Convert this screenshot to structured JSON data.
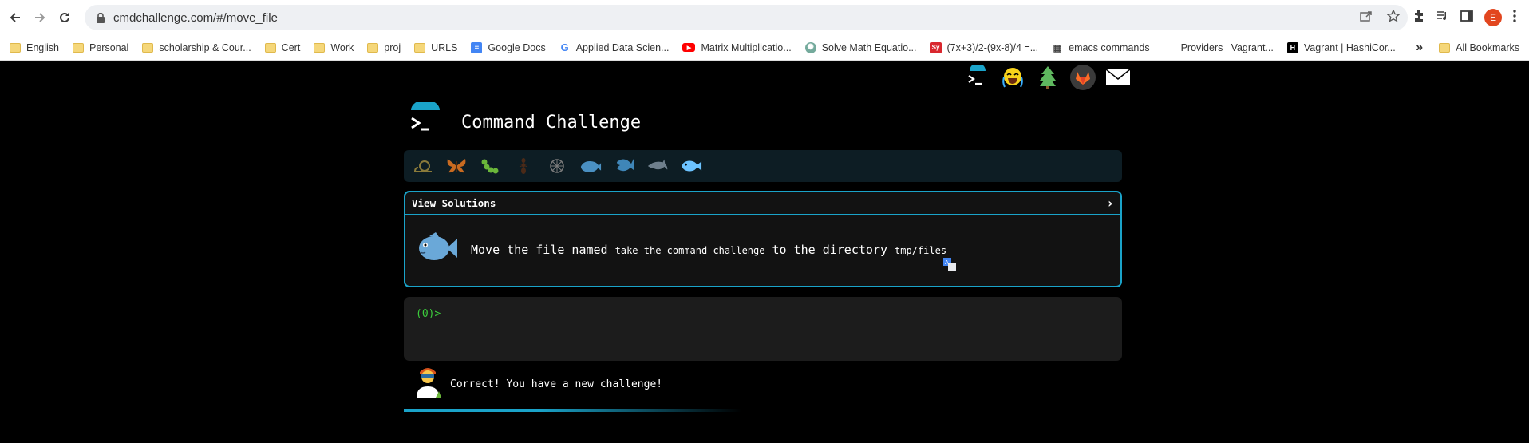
{
  "browser": {
    "url": "cmdchallenge.com/#/move_file",
    "profile_initial": "E",
    "bookmarks": [
      {
        "label": "English",
        "icon": "folder-icon"
      },
      {
        "label": "Personal",
        "icon": "folder-icon"
      },
      {
        "label": "scholarship & Cour...",
        "icon": "folder-icon"
      },
      {
        "label": "Cert",
        "icon": "folder-icon"
      },
      {
        "label": "Work",
        "icon": "folder-icon"
      },
      {
        "label": "proj",
        "icon": "folder-icon"
      },
      {
        "label": "URLS",
        "icon": "folder-icon"
      },
      {
        "label": "Google Docs",
        "icon": "google-docs-icon"
      },
      {
        "label": "Applied Data Scien...",
        "icon": "google-icon"
      },
      {
        "label": "Matrix Multiplicatio...",
        "icon": "youtube-icon"
      },
      {
        "label": "Solve Math Equatio...",
        "icon": "chatgpt-icon"
      },
      {
        "label": "(7x+3)/2-(9x-8)/4 =...",
        "icon": "symbolab-icon"
      },
      {
        "label": "emacs commands",
        "icon": "grid-icon"
      },
      {
        "label": "Providers | Vagrant...",
        "icon": "none"
      },
      {
        "label": "Vagrant | HashiCor...",
        "icon": "hashicorp-icon"
      }
    ],
    "overflow_label": "»",
    "all_bookmarks_label": "All Bookmarks"
  },
  "page": {
    "title": "Command Challenge",
    "view_solutions_label": "View Solutions",
    "chevron": "›",
    "task_prefix": "Move the file named",
    "task_file": "take-the-command-challenge",
    "task_middle": "to the directory",
    "task_dir": "tmp/files",
    "prompt": "(0)>",
    "result_message": "Correct! You have a new challenge!",
    "progress_fraction": 0.47,
    "level_icons": [
      "snail-icon",
      "butterfly-icon",
      "caterpillar-icon",
      "ant-icon",
      "shell-icon",
      "whale-icon",
      "shark-icon",
      "dolphin-icon",
      "fish-icon"
    ],
    "top_icons": [
      "terminal-logo-icon",
      "laughing-emoji-icon",
      "tree-icon",
      "gitlab-icon",
      "mail-icon"
    ]
  },
  "colors": {
    "accent": "#1aa3c9",
    "prompt_green": "#3ccc3c",
    "background": "#000000"
  }
}
